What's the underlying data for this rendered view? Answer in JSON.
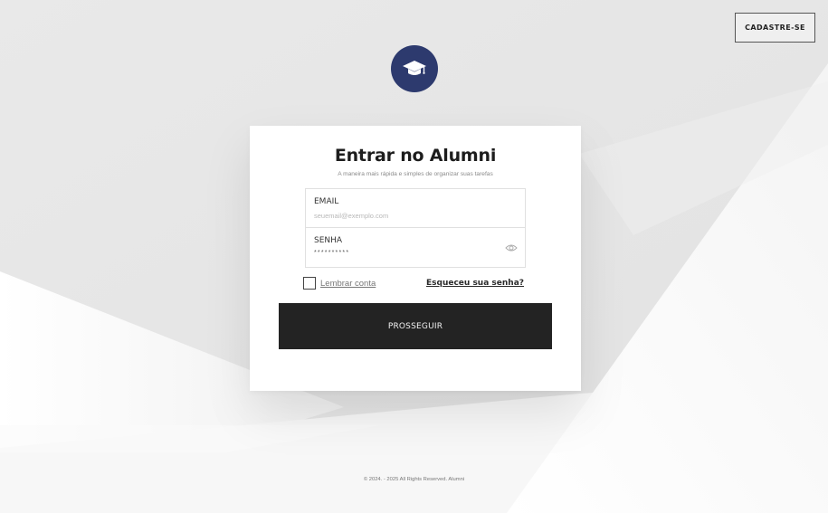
{
  "header": {
    "register_label": "CADASTRE-SE"
  },
  "logo": {
    "icon": "graduation-cap-icon",
    "color": "#2d3a6e"
  },
  "login": {
    "title": "Entrar no Alumni",
    "subtitle": "A maneira mais rápida e simples de organizar suas tarefas",
    "email": {
      "label": "EMAIL",
      "placeholder": "seuemail@exemplo.com",
      "value": ""
    },
    "password": {
      "label": "SENHA",
      "value": "**********",
      "toggle_icon": "eye-icon"
    },
    "remember_label": "Lembrar conta",
    "remember_checked": false,
    "forgot_label": "Esqueceu sua senha?",
    "submit_label": "PROSSEGUIR"
  },
  "footer": {
    "text": "© 2024. - 2025 All Rights Reserved. Alumni"
  }
}
